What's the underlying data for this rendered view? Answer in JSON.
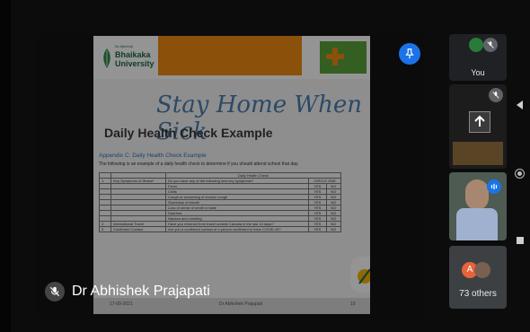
{
  "slide": {
    "university_small": "Ila Ajitsinhji",
    "university_name_line1": "Bhaikaka",
    "university_name_line2": "University",
    "title_handwritten": "Stay Home When Sick",
    "title": "Daily Health Check Example",
    "appendix_heading": "Appendix C: Daily Health Check Example",
    "intro_text": "The following is an example of a daily health check to determine if you should attend school that day.",
    "table": {
      "header": "Daily Health Check",
      "rows": [
        {
          "num": "1.",
          "category": "Key Symptoms of Illness*",
          "question": "Do you have any of the following new key symptoms?",
          "answer": "CIRCLE ONE",
          "answer2": ""
        },
        {
          "num": "",
          "category": "",
          "question": "Fever",
          "answer": "YES",
          "answer2": "NO"
        },
        {
          "num": "",
          "category": "",
          "question": "Chills",
          "answer": "YES",
          "answer2": "NO"
        },
        {
          "num": "",
          "category": "",
          "question": "Cough or worsening of chronic cough",
          "answer": "YES",
          "answer2": "NO"
        },
        {
          "num": "",
          "category": "",
          "question": "Shortness of breath",
          "answer": "YES",
          "answer2": "NO"
        },
        {
          "num": "",
          "category": "",
          "question": "Loss of sense of smell or taste",
          "answer": "YES",
          "answer2": "NO"
        },
        {
          "num": "",
          "category": "",
          "question": "Diarrhea",
          "answer": "YES",
          "answer2": "NO"
        },
        {
          "num": "",
          "category": "",
          "question": "Nausea and vomiting",
          "answer": "YES",
          "answer2": "NO"
        },
        {
          "num": "2.",
          "category": "International Travel",
          "question": "Have you returned from travel outside Canada in the last 14 days?",
          "answer": "YES",
          "answer2": "NO"
        },
        {
          "num": "3.",
          "category": "Confirmed Contact",
          "question": "Are you a confirmed contact of a person confirmed to have COVID-19?",
          "answer": "YES",
          "answer2": "NO"
        }
      ]
    },
    "footer_date": "17-09-2021",
    "footer_presenter": "Dr Abhishek Prajapati",
    "footer_page": "10"
  },
  "main": {
    "speaker_name": "Dr Abhishek Prajapati"
  },
  "sidebar": {
    "you_label": "You",
    "others_initial": "A",
    "others_label": "73 others"
  },
  "colors": {
    "brand_orange": "#f08a12",
    "brand_green": "#1a6b3e",
    "pin_blue": "#1a73e8"
  }
}
